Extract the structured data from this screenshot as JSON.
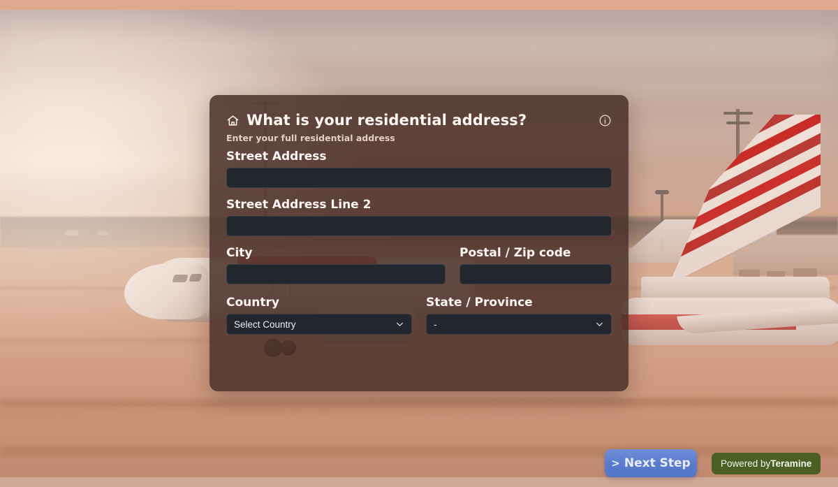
{
  "page": {
    "background_alt": "airport tarmac with American Airlines aircraft tail",
    "top_bar_color": "#e0a88e",
    "bottom_bar_color": "#cfa795"
  },
  "card": {
    "home_icon": "home-icon",
    "title": "What is your residential address?",
    "info_icon": "info-circle-icon",
    "subtitle": "Enter your full residential address",
    "background_color": "#4a302a",
    "fields": {
      "street_address": {
        "label": "Street Address",
        "value": "",
        "placeholder": ""
      },
      "street_address_2": {
        "label": "Street Address Line 2",
        "value": "",
        "placeholder": ""
      },
      "city": {
        "label": "City",
        "value": "",
        "placeholder": ""
      },
      "postal_code": {
        "label": "Postal / Zip code",
        "value": "",
        "placeholder": ""
      },
      "country": {
        "label": "Country",
        "selected": "Select Country",
        "chevron_icon": "chevron-down-icon"
      },
      "state_province": {
        "label": "State / Province",
        "selected": "-",
        "chevron_icon": "chevron-down-icon"
      }
    }
  },
  "footer": {
    "next_step": {
      "chevron": ">",
      "label": "Next Step",
      "color": "#5b7bcd"
    },
    "powered_by": {
      "prefix": "Powered by",
      "brand": "Teramine",
      "color": "#4b5e24"
    }
  }
}
